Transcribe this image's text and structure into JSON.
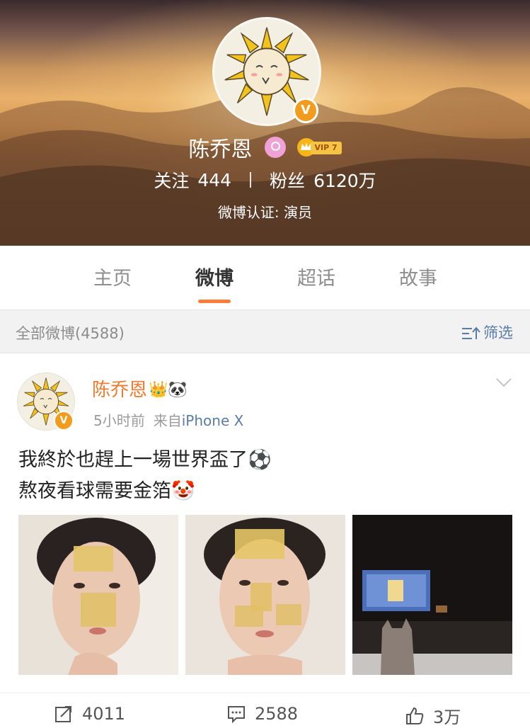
{
  "profile": {
    "name": "陈乔恩",
    "vip_label": "VIP 7",
    "following_label": "关注",
    "following_count": "444",
    "followers_label": "粉丝",
    "followers_count": "6120万",
    "verification": "微博认证: 演员",
    "badge_letter": "V"
  },
  "tabs": [
    {
      "label": "主页",
      "active": false
    },
    {
      "label": "微博",
      "active": true
    },
    {
      "label": "超话",
      "active": false
    },
    {
      "label": "故事",
      "active": false
    }
  ],
  "filter_bar": {
    "label": "全部微博(4588)",
    "filter_label": "筛选"
  },
  "post": {
    "author": "陈乔恩",
    "author_emojis": "👑🐼",
    "time": "5小时前",
    "source_prefix": "来自",
    "source": "iPhone X",
    "text_line1": "我終於也趕上一場世界盃了⚽",
    "text_line2": "熬夜看球需要金箔🤡",
    "photos": [
      "gold-foil-face-selfie-1",
      "gold-foil-face-selfie-2",
      "dog-watching-world-cup-tv"
    ],
    "repost_count": "4011",
    "comment_count": "2588",
    "like_count": "3万"
  },
  "colors": {
    "accent": "#fa7d3c",
    "author_name": "#f07a2e",
    "link": "#5a7ca6",
    "verify_badge": "#f29b1c"
  }
}
